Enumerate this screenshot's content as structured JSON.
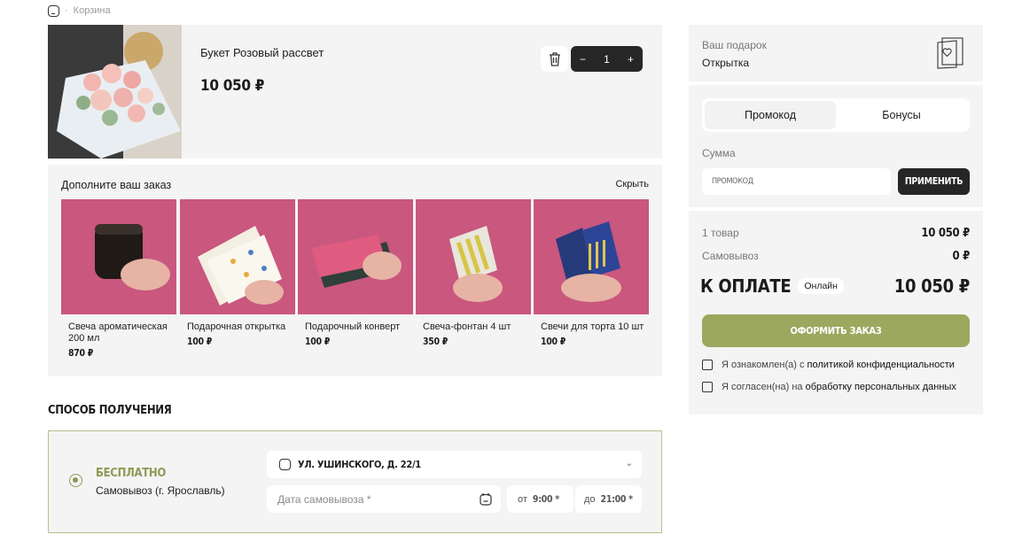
{
  "breadcrumb": {
    "current": "Корзина"
  },
  "cart_item": {
    "name": "Букет Розовый рассвет",
    "price": "10 050 ₽",
    "quantity": "1",
    "minus": "−",
    "plus": "+"
  },
  "upsell": {
    "title": "Дополните ваш заказ",
    "hide_label": "Скрыть",
    "products": [
      {
        "name": "Свеча ароматическая 200 мл",
        "price": "870 ₽"
      },
      {
        "name": "Подарочная открытка",
        "price": "100 ₽"
      },
      {
        "name": "Подарочный конверт",
        "price": "100 ₽"
      },
      {
        "name": "Свеча-фонтан 4 шт",
        "price": "350 ₽"
      },
      {
        "name": "Свечи для торта 10 шт",
        "price": "100 ₽"
      }
    ]
  },
  "delivery": {
    "title": "Способ получения",
    "option_price": "Бесплатно",
    "option_name": "Самовывоз (г. Ярославль)",
    "address": "ул. Ушинского, д. 22/1",
    "date_placeholder": "Дата самовывоза *",
    "from_label": "от",
    "from_value": "9:00 *",
    "to_label": "до",
    "to_value": "21:00 *"
  },
  "gift": {
    "label": "Ваш подарок",
    "value": "Открытка"
  },
  "promo": {
    "tabs": [
      "Промокод",
      "Бонусы"
    ],
    "sum_label": "Сумма",
    "input_placeholder": "ПРОМОКОД",
    "apply_label": "ПРИМЕНИТЬ"
  },
  "summary": {
    "items_label": "1 товар",
    "items_value": "10 050 ₽",
    "pickup_label": "Самовывоз",
    "pickup_value": "0 ₽",
    "pay_label": "К оплате",
    "pay_badge": "Онлайн",
    "pay_value": "10 050 ₽",
    "order_button": "ОФОРМИТЬ ЗАКАЗ",
    "consent1_prefix": "Я ознакомлен(а) с",
    "consent1_link": "политикой конфиденциальности",
    "consent2_prefix": "Я согласен(на) на",
    "consent2_link": "обработку персональных данных"
  },
  "colors": {
    "accent": "#9da85f",
    "dark": "#262626",
    "panel": "#f4f4f4",
    "radio": "#8c9a55"
  }
}
